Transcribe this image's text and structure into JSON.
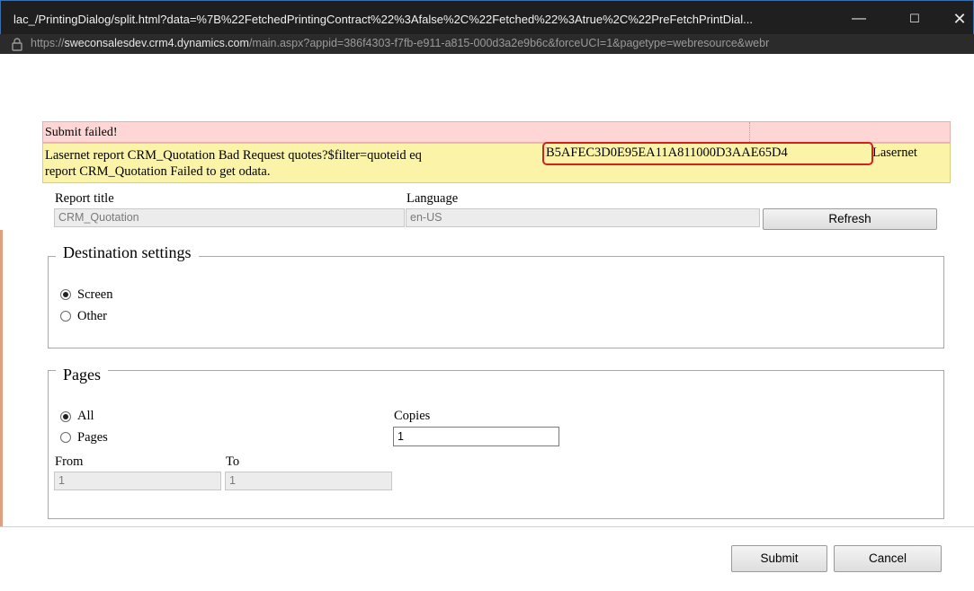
{
  "window": {
    "title": "lac_/PrintingDialog/split.html?data=%7B%22FetchedPrintingContract%22%3Afalse%2C%22Fetched%22%3Atrue%2C%22PreFetchPrintDial...",
    "minimize_glyph": "—",
    "maximize_glyph": "☐",
    "close_glyph": "✕"
  },
  "address": {
    "scheme": "https://",
    "host": "sweconsalesdev.crm4.dynamics.com",
    "path": "/main.aspx?appid=386f4303-f7fb-e911-a815-000d3a2e9b6c&forceUCI=1&pagetype=webresource&webr"
  },
  "error": {
    "heading": "Submit failed!",
    "line1_prefix": "Lasernet report CRM_Quotation Bad Request quotes?$filter=quoteid eq",
    "quote_id": "B5AFEC3D0E95EA11A811000D3AAE65D4",
    "line1_suffix": "Lasernet",
    "line2": "report CRM_Quotation Failed to get odata."
  },
  "report": {
    "title_label": "Report title",
    "title_value": "CRM_Quotation",
    "language_label": "Language",
    "language_value": "en-US",
    "refresh_label": "Refresh"
  },
  "destination": {
    "legend": "Destination settings",
    "options": [
      {
        "label": "Screen",
        "checked": true
      },
      {
        "label": "Other",
        "checked": false
      }
    ]
  },
  "pages": {
    "legend": "Pages",
    "options": [
      {
        "label": "All",
        "checked": true
      },
      {
        "label": "Pages",
        "checked": false
      }
    ],
    "copies_label": "Copies",
    "copies_value": "1",
    "from_label": "From",
    "from_value": "1",
    "to_label": "To",
    "to_value": "1"
  },
  "actions": {
    "submit_label": "Submit",
    "cancel_label": "Cancel"
  },
  "colors": {
    "error_heading_bg": "#ffd6d6",
    "error_detail_bg": "#fbf4a8",
    "highlight_border": "#d42020"
  },
  "icons": {
    "address_lock": "lock-icon"
  }
}
